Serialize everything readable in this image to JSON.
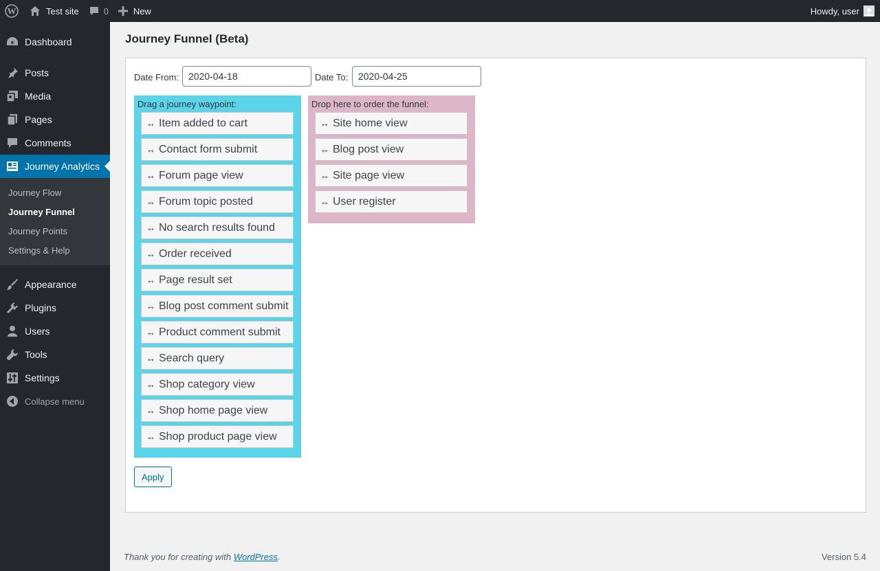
{
  "admin_bar": {
    "site_name": "Test site",
    "comments_count": "0",
    "new_label": "New",
    "greeting": "Howdy, user"
  },
  "sidebar": {
    "items_top": [
      {
        "label": "Dashboard",
        "icon": "dashboard-icon"
      },
      {
        "label": "Posts",
        "icon": "pin-icon"
      },
      {
        "label": "Media",
        "icon": "media-icon"
      },
      {
        "label": "Pages",
        "icon": "pages-icon"
      },
      {
        "label": "Comments",
        "icon": "comments-icon"
      }
    ],
    "current": {
      "label": "Journey Analytics",
      "icon": "analytics-icon"
    },
    "submenu": [
      {
        "label": "Journey Flow",
        "active": false
      },
      {
        "label": "Journey Funnel",
        "active": true
      },
      {
        "label": "Journey Points",
        "active": false
      },
      {
        "label": "Settings & Help",
        "active": false
      }
    ],
    "items_bottom": [
      {
        "label": "Appearance",
        "icon": "brush-icon"
      },
      {
        "label": "Plugins",
        "icon": "plugin-icon"
      },
      {
        "label": "Users",
        "icon": "user-icon"
      },
      {
        "label": "Tools",
        "icon": "wrench-icon"
      },
      {
        "label": "Settings",
        "icon": "settings-icon"
      }
    ],
    "collapse_label": "Collapse menu"
  },
  "page": {
    "title": "Journey Funnel (Beta)",
    "date_from_label": "Date From:",
    "date_from_value": "2020-04-18",
    "date_to_label": "Date To:",
    "date_to_value": "2020-04-25",
    "source_label": "Drag a journey waypoint:",
    "target_label": "Drop here to order the funnel:",
    "source_waypoints": [
      "Item added to cart",
      "Contact form submit",
      "Forum page view",
      "Forum topic posted",
      "No search results found",
      "Order received",
      "Page result set",
      "Blog post comment submit",
      "Product comment submit",
      "Search query",
      "Shop category view",
      "Shop home page view",
      "Shop product page view"
    ],
    "funnel_waypoints": [
      "Site home view",
      "Blog post view",
      "Site page view",
      "User register"
    ],
    "grip_glyph": "↔",
    "apply_label": "Apply"
  },
  "footer": {
    "thanks_prefix": "Thank you for creating with ",
    "thanks_link": "WordPress",
    "thanks_suffix": ".",
    "version": "Version 5.4"
  },
  "colors": {
    "admin_dark": "#23282d",
    "accent": "#0073aa",
    "source_zone": "#5bd3e8",
    "target_zone": "#dcb6c6"
  }
}
